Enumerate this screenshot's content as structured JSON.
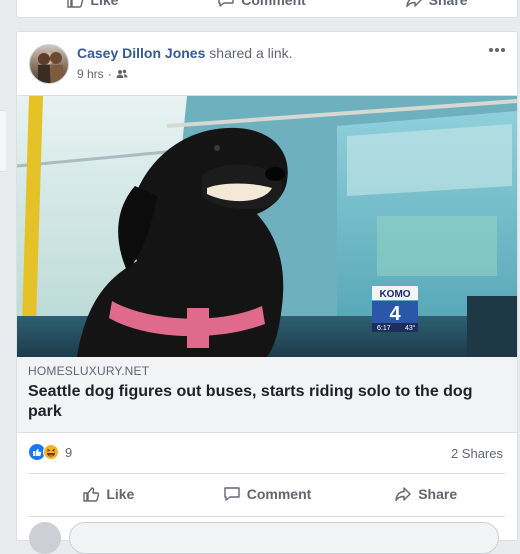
{
  "previous_post": {
    "like_label": "Like",
    "comment_label": "Comment",
    "share_label": "Share"
  },
  "post": {
    "author": "Casey Dillon Jones",
    "action": "shared a link.",
    "time": "9 hrs",
    "audience_icon": "friends-icon",
    "link": {
      "domain": "HOMESLUXURY.NET",
      "title": "Seattle dog figures out buses, starts riding solo to the dog park",
      "image_watermark": "KOMO",
      "image_watermark_number": "4",
      "image_clock": "6:17",
      "image_temp": "43°"
    },
    "reactions": {
      "icons": [
        "like-reaction-icon",
        "haha-reaction-icon"
      ],
      "count": "9"
    },
    "shares": "2 Shares",
    "actions": {
      "like_label": "Like",
      "comment_label": "Comment",
      "share_label": "Share"
    }
  },
  "colors": {
    "link_name": "#385898",
    "secondary_text": "#606770",
    "page_bg": "#e9ebee",
    "like_blue": "#1877f2",
    "haha_yellow": "#f7b125"
  }
}
